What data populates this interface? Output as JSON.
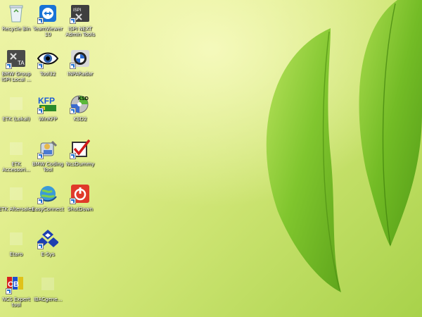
{
  "desktop": {
    "icons": [
      {
        "label": "Recycle Bin",
        "icon": "recycle-bin-icon"
      },
      {
        "label": "TeamViewer\n10",
        "icon": "teamviewer-icon"
      },
      {
        "label": "ISPI NEXT\nAdmin Tools",
        "icon": "ispi-next-icon"
      },
      {
        "label": "BMW Group\nISPI Local ...",
        "icon": "bmw-group-ta-icon"
      },
      {
        "label": "Tool32",
        "icon": "eye-icon"
      },
      {
        "label": "INPARadar",
        "icon": "bmw-logo-icon"
      },
      {
        "label": "ETK (Lokal)",
        "icon": "etk-icon"
      },
      {
        "label": "WinKFP",
        "icon": "winkfp-icon"
      },
      {
        "label": "KSD2",
        "icon": "ksd2-disc-icon"
      },
      {
        "label": "ETK\nAccessori...",
        "icon": "etk-accessories-icon"
      },
      {
        "label": "BMW Coding\nTool",
        "icon": "coding-tool-icon"
      },
      {
        "label": "NcsDummy",
        "icon": "checkmark-icon"
      },
      {
        "label": "ETK Aftersales",
        "icon": "etk-aftersales-icon"
      },
      {
        "label": "EasyConnect",
        "icon": "globe-connect-icon"
      },
      {
        "label": "ShutDown",
        "icon": "power-icon"
      },
      {
        "label": "Etaro",
        "icon": "etaro-icon"
      },
      {
        "label": "E-Sys",
        "icon": "esys-icon"
      },
      {
        "label": "NCS Expert\ntool",
        "icon": "ncs-expert-icon"
      },
      {
        "label": "IBACgene...",
        "icon": "ibac-icon"
      }
    ]
  },
  "colors": {
    "background": "#e2ee8e",
    "leaf": "#7cc42a",
    "leaf_dark": "#4f8f12"
  }
}
